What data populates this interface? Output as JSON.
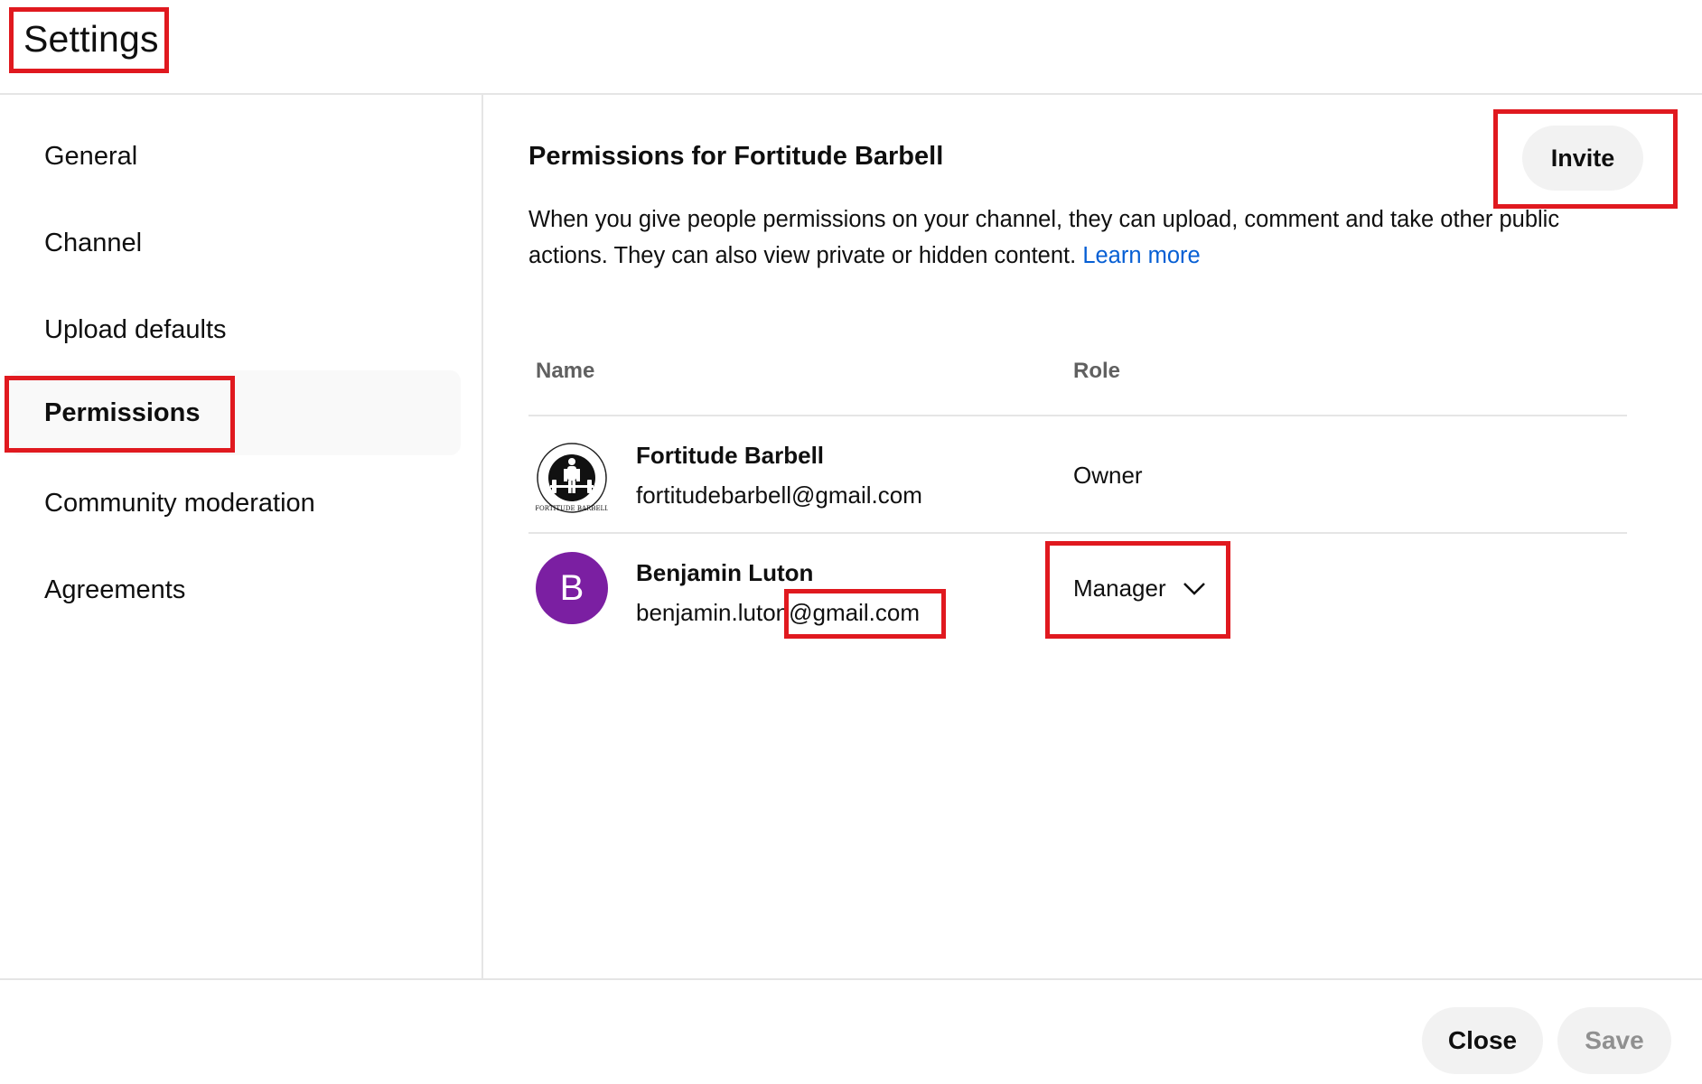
{
  "header": {
    "title": "Settings"
  },
  "sidebar": {
    "items": [
      {
        "label": "General"
      },
      {
        "label": "Channel"
      },
      {
        "label": "Upload defaults"
      },
      {
        "label": "Permissions",
        "active": true
      },
      {
        "label": "Community moderation"
      },
      {
        "label": "Agreements"
      }
    ]
  },
  "permissions": {
    "title": "Permissions for Fortitude Barbell",
    "invite_label": "Invite",
    "description": "When you give people permissions on your channel, they can upload, comment and take other public actions. They can also view private or hidden content.",
    "learn_more": "Learn more",
    "columns": {
      "name": "Name",
      "role": "Role"
    },
    "rows": [
      {
        "name": "Fortitude Barbell",
        "email": "fortitudebarbell@gmail.com",
        "role": "Owner",
        "avatar": "fortitude-barbell-logo",
        "logo_text": "FORTITUDE BARBELL"
      },
      {
        "name": "Benjamin Luton",
        "email": "benjamin.luton@gmail.com",
        "role": "Manager",
        "avatar_letter": "B",
        "avatar_color": "#7b1fa2"
      }
    ]
  },
  "footer": {
    "close_label": "Close",
    "save_label": "Save"
  },
  "colors": {
    "highlight": "#e0191f",
    "link": "#065fd4",
    "accent_avatar": "#7b1fa2"
  },
  "icons": {
    "dropdown": "chevron-down-icon"
  }
}
